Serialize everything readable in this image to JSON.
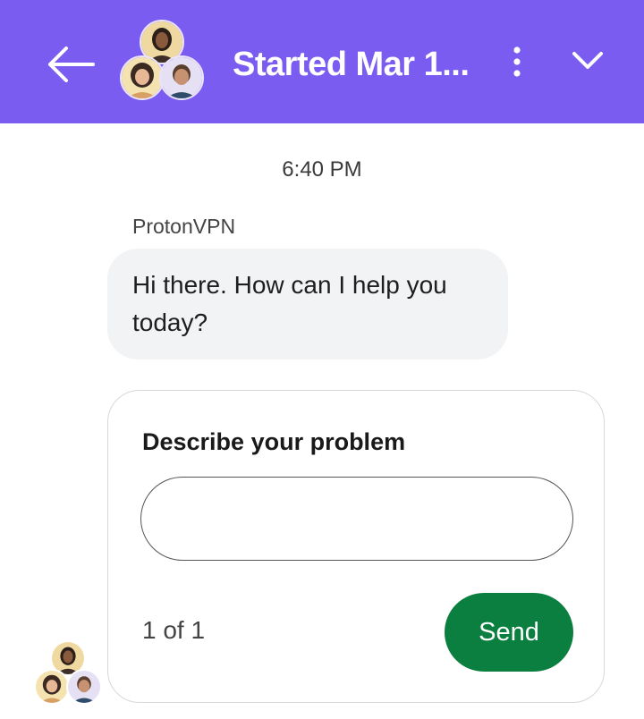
{
  "header": {
    "title": "Started Mar 1...",
    "background": "#7b5cf0",
    "back_icon": "arrow-left-icon",
    "more_icon": "vertical-dots-icon",
    "collapse_icon": "chevron-down-icon"
  },
  "conversation": {
    "timestamp": "6:40 PM",
    "sender": "ProtonVPN",
    "message": "Hi there. How can I help you today?"
  },
  "form_card": {
    "title": "Describe your problem",
    "input_value": "",
    "pager": "1 of 1",
    "send_label": "Send",
    "send_color": "#0b7f3f"
  }
}
